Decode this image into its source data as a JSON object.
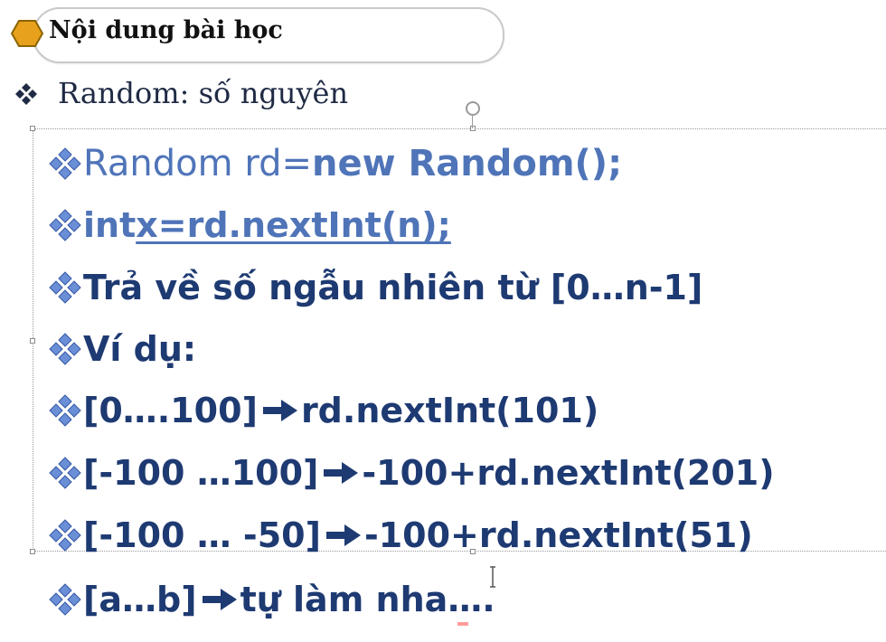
{
  "header": {
    "title": "Nội dung bài học"
  },
  "topic": {
    "text": "Random: số nguyên"
  },
  "lines": [
    {
      "parts": [
        {
          "text": " Random rd=",
          "style": "light"
        },
        {
          "text": "new Random();",
          "style": "strong"
        }
      ]
    },
    {
      "parts": [
        {
          "text": "int ",
          "style": "blue"
        },
        {
          "text": "x=rd.nextInt(n);",
          "style": "blue-underline"
        }
      ]
    },
    {
      "text": "Trả về số ngẫu nhiên từ [0…n-1]"
    },
    {
      "text": "Ví dụ:"
    },
    {
      "left": "[0….100]",
      "right": "rd.nextInt(101)"
    },
    {
      "left": "[-100 …100]",
      "right": "-100+rd.nextInt(201)"
    },
    {
      "left": "[-100 … -50]",
      "right": "-100+rd.nextInt(51)"
    },
    {
      "left": "[a…b]",
      "right": "tự làm nha…."
    }
  ],
  "icons": {
    "title": "hexagon-icon",
    "bullet": "four-diamond-bullet-icon",
    "arrow": "right-arrow-icon",
    "rotate": "rotate-handle-icon",
    "cursor": "text-cursor-icon"
  },
  "colors": {
    "title_hexagon": "#e7a11c",
    "bullet_blue": "#6b8fd6",
    "dark_blue_text": "#1e3a72",
    "code_blue": "#4f74b8",
    "black": "#111111"
  }
}
